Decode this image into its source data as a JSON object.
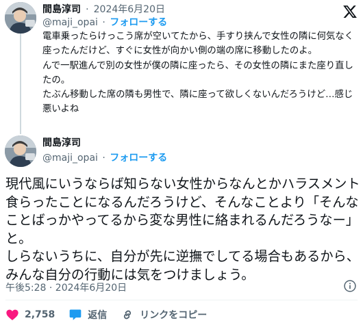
{
  "parent_tweet": {
    "author_name": "間島淳司",
    "date": "2024年6月20日",
    "handle": "@maji_opai",
    "follow_label": "フォローする",
    "text": "電車乗ったらけっこう席が空いてたから、手すり挟んで女性の隣に何気なく座ったんだけど、すぐに女性が向かい側の端の席に移動したのよ。\nんで一駅進んで別の女性が僕の隣に座ったら、その女性の隣にまた座り直したの。\nたぶん移動した席の隣も男性で、隣に座って欲しくないんだろうけど…感じ悪いよね"
  },
  "main_tweet": {
    "author_name": "間島淳司",
    "handle": "@maji_opai",
    "follow_label": "フォローする",
    "text": "現代風にいうならば知らない女性からなんとかハラスメント食らったことになるんだろうけど、そんなことより「そんなことばっかやってるから変な男性に絡まれるんだろうなー」と。\nしらないうちに、自分が先に逆撫でしてる場合もあるから、みんな自分の行動には気をつけましょう。",
    "timestamp": "午後5:28 · 2024年6月20日"
  },
  "actions": {
    "like_count": "2,758",
    "reply_label": "返信",
    "copy_link_label": "リンクをコピー"
  },
  "colors": {
    "text": "#0f1419",
    "muted": "#536471",
    "link": "#1d9bf0",
    "like": "#f91880",
    "divider": "#eff3f4"
  },
  "icons": {
    "brand": "x-logo-icon",
    "info": "info-icon",
    "like": "heart-icon",
    "reply": "speech-bubble-icon",
    "copy_link": "link-icon"
  }
}
